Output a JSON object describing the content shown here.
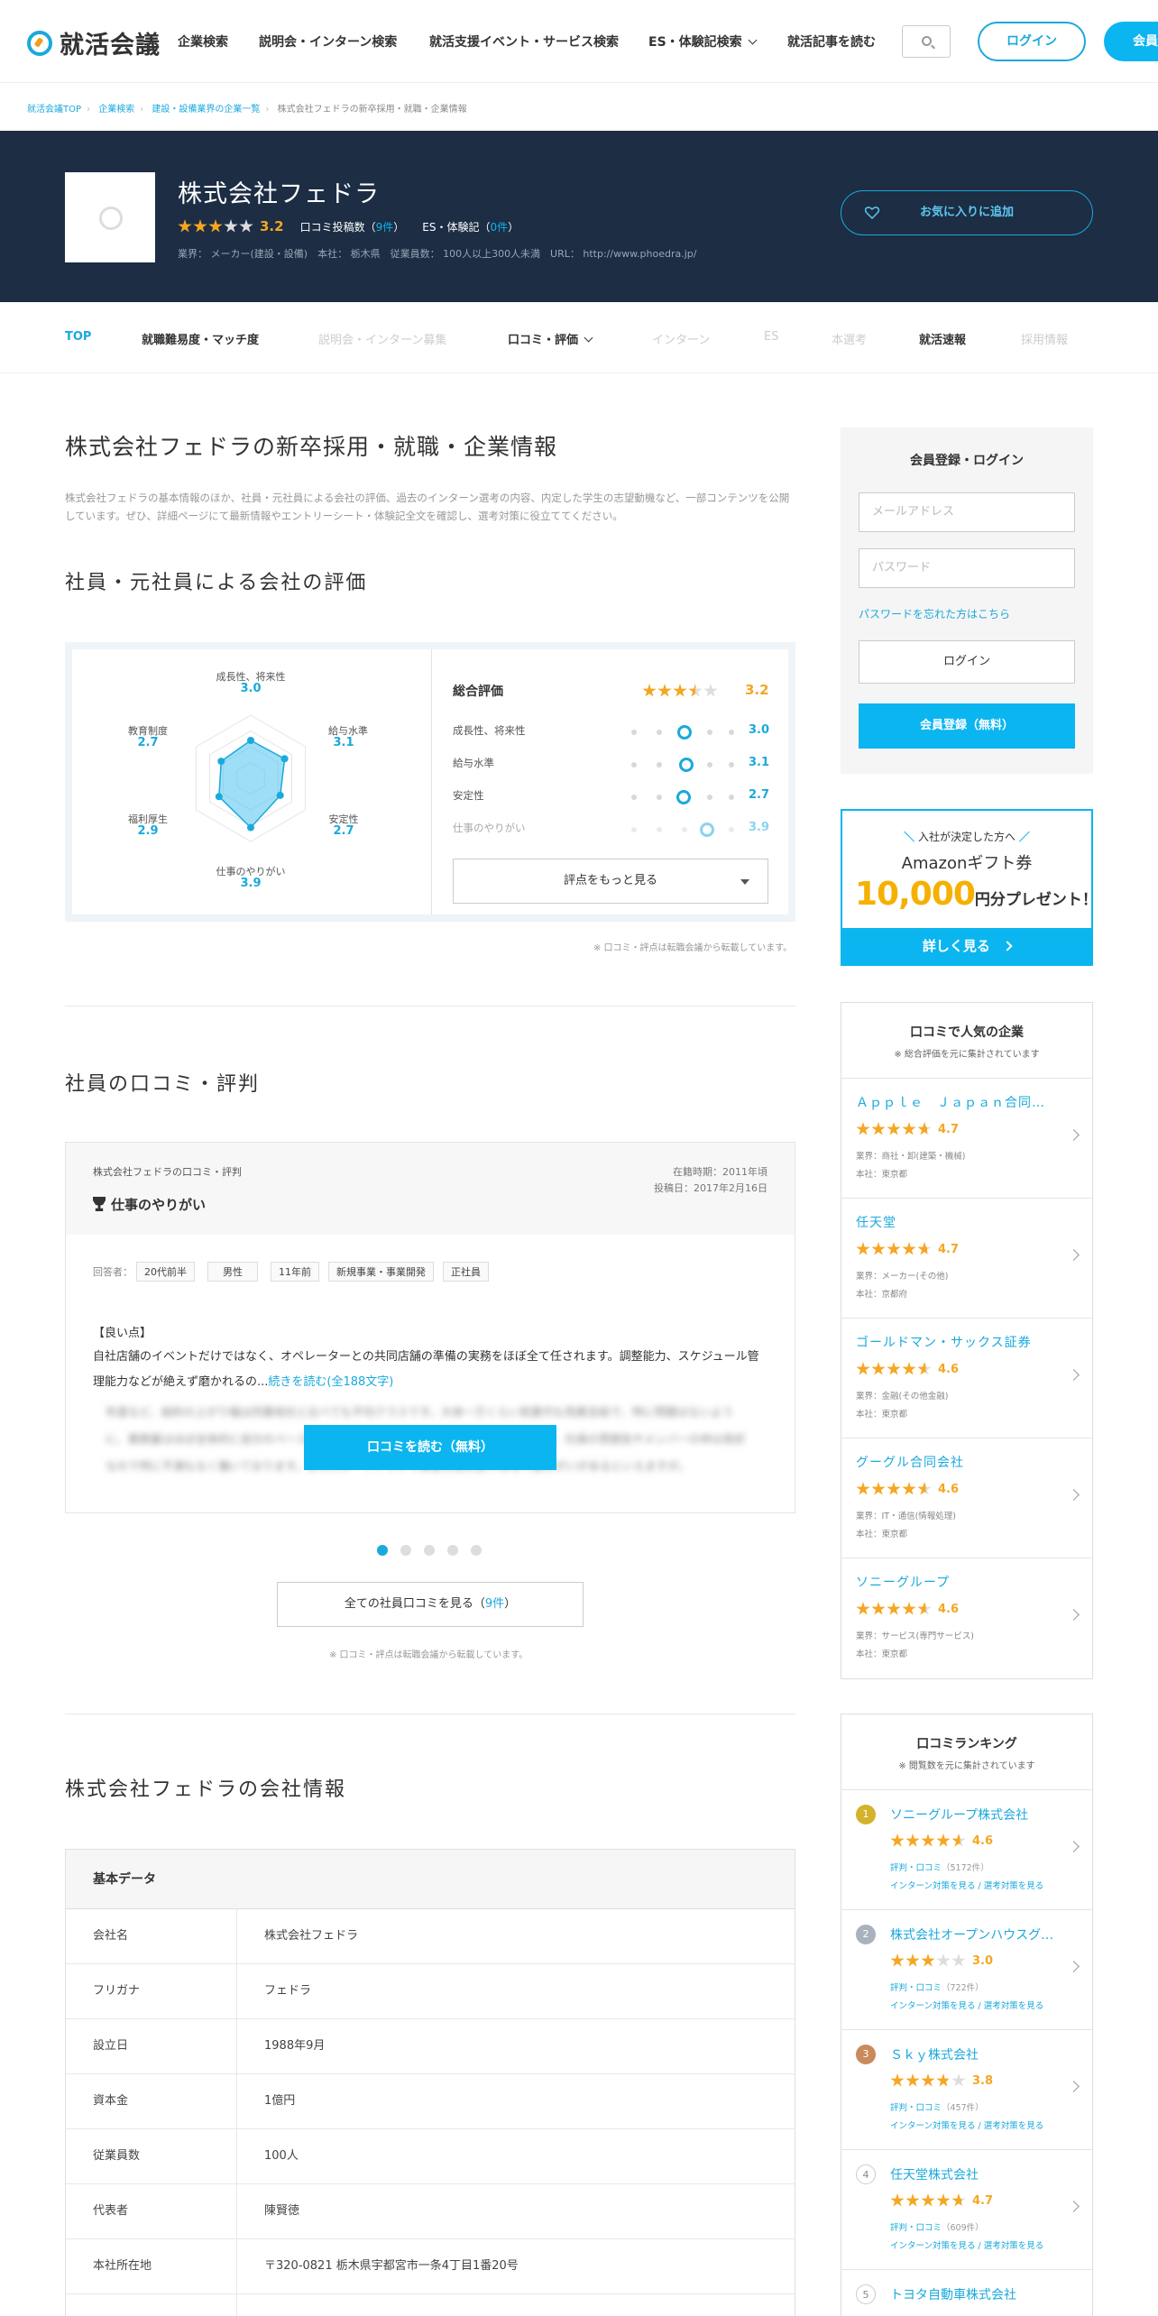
{
  "header": {
    "logo_text": "就活会議",
    "nav": [
      "企業検索",
      "説明会・インターン検索",
      "就活支援イベント・サービス検索",
      "ES・体験記検索",
      "就活記事を読む"
    ],
    "login": "ログイン",
    "register": "会員登録"
  },
  "breadcrumb": [
    "就活会議TOP",
    "企業検索",
    "建設・設備業界の企業一覧",
    "株式会社フェドラの新卒採用・就職・企業情報"
  ],
  "company": {
    "name": "株式会社フェドラ",
    "score": "3.2",
    "reviews_label": "口コミ投稿数（",
    "reviews_count": "9件",
    "es_label": "ES・体験記（",
    "es_count": "0件",
    "close": "）",
    "info": "業界： メーカー(建設・設備)　本社： 栃木県　従業員数： 100人以上300人未満　URL： http://www.phoedra.jp/",
    "favorite": "お気に入りに追加"
  },
  "tabs": [
    "TOP",
    "就職難易度・マッチ度",
    "説明会・インターン募集",
    "口コミ・評価",
    "インターン",
    "ES",
    "本選考",
    "就活速報",
    "採用情報"
  ],
  "main": {
    "title": "株式会社フェドラの新卒採用・就職・企業情報",
    "lead": "株式会社フェドラの基本情報のほか、社員・元社員による会社の評価、過去のインターン選考の内容、内定した学生の志望動機など、一部コンテンツを公開しています。ぜひ、詳細ページにて最新情報やエントリーシート・体験記全文を確認し、選考対策に役立ててください。",
    "rating_title": "社員・元社員による会社の評価",
    "radar": [
      {
        "label": "成長性、将来性",
        "value": "3.0"
      },
      {
        "label": "給与水準",
        "value": "3.1"
      },
      {
        "label": "安定性",
        "value": "2.7"
      },
      {
        "label": "仕事のやりがい",
        "value": "3.9"
      },
      {
        "label": "福利厚生",
        "value": "2.9"
      },
      {
        "label": "教育制度",
        "value": "2.7"
      }
    ],
    "total_label": "総合評価",
    "total_score": "3.2",
    "scores": [
      {
        "label": "成長性、将来性",
        "value": "3.0"
      },
      {
        "label": "給与水準",
        "value": "3.1"
      },
      {
        "label": "安定性",
        "value": "2.7"
      },
      {
        "label": "仕事のやりがい",
        "value": "3.9"
      }
    ],
    "more_scores": "評点をもっと見る",
    "note": "※ 口コミ・評点は転職会議から転載しています。",
    "review_title": "社員の口コミ・評判",
    "review": {
      "source": "株式会社フェドラの口コミ・評判",
      "tenure": "在籍時期：2011年頃",
      "posted": "投稿日：2017年2月16日",
      "category": "仕事のやりがい",
      "answerer": "回答者：",
      "tags": [
        "20代前半",
        "男性",
        "11年前",
        "新規事業・事業開発",
        "正社員"
      ],
      "good_label": "【良い点】",
      "body": "自社店舗のイベントだけではなく、オペレーターとの共同店舗の準備の実務をほぼ全て任されます。調整能力、スケジュール管理能力などが絶えず磨かれるの...",
      "read_more": "続きを読む(全188文字)",
      "blur": "年度など、給料の上がり幅は同業他社と比べても平均クラスです。大体一万くらい就業代も残業支給で、特に問題はないように、業務量はほぼ全体的に自分のペースで調整できるというわけではないようです。ただ、社員の雰囲気やメンバーの仲は良好なので特に不満もなく働いております。またスタートアップで事業も会社並ではなく働きがいがあるといえますが。",
      "read_btn": "口コミを読む（無料）"
    },
    "all_reviews": "全ての社員口コミを見る（",
    "all_reviews_count": "9件",
    "info_title": "株式会社フェドラの会社情報",
    "table_head": "基本データ",
    "table": [
      {
        "k": "会社名",
        "v": "株式会社フェドラ"
      },
      {
        "k": "フリガナ",
        "v": "フェドラ"
      },
      {
        "k": "設立日",
        "v": "1988年9月"
      },
      {
        "k": "資本金",
        "v": "1億円"
      },
      {
        "k": "従業員数",
        "v": "100人"
      },
      {
        "k": "代表者",
        "v": "陳賢徳"
      },
      {
        "k": "本社所在地",
        "v": "〒320-0821 栃木県宇都宮市一条4丁目1番20号"
      }
    ]
  },
  "sidebar": {
    "login": {
      "title": "会員登録・ログイン",
      "email_ph": "メールアドレス",
      "password_ph": "パスワード",
      "forgot": "パスワードを忘れた方はこちら",
      "login": "ログイン",
      "register": "会員登録（無料）"
    },
    "amazon": {
      "top": "入社が決定した方へ",
      "mid": "Amazonギフト券",
      "num": "10,000",
      "txt": "円分プレゼント！",
      "btn": "詳しく見る"
    },
    "popular": {
      "title": "口コミで人気の企業",
      "sub": "※ 総合評価を元に集計されています",
      "items": [
        {
          "name": "Ａｐｐｌｅ　Ｊａｐａｎ合同会社",
          "score": "4.7",
          "industry": "業界：商社・卸(建築・機械)",
          "hq": "本社：東京都",
          "stars": 4.7
        },
        {
          "name": "任天堂",
          "score": "4.7",
          "industry": "業界：メーカー(その他)",
          "hq": "本社：京都府",
          "stars": 4.7
        },
        {
          "name": "ゴールドマン・サックス証券",
          "score": "4.6",
          "industry": "業界：金融(その他金融)",
          "hq": "本社：東京都",
          "stars": 4.6
        },
        {
          "name": "グーグル合同会社",
          "score": "4.6",
          "industry": "業界：IT・通信(情報処理)",
          "hq": "本社：東京都",
          "stars": 4.6
        },
        {
          "name": "ソニーグループ",
          "score": "4.6",
          "industry": "業界：サービス(専門サービス)",
          "hq": "本社：東京都",
          "stars": 4.6
        }
      ]
    },
    "ranking": {
      "title": "口コミランキング",
      "sub": "※ 閲覧数を元に集計されています",
      "links": "インターン対策を見る / 選考対策を見る",
      "items": [
        {
          "rank": "1",
          "name": "ソニーグループ株式会社",
          "score": "4.6",
          "reviews": "評判・口コミ",
          "count": "（5172件）",
          "stars": 4.6,
          "color": "#d4b22a"
        },
        {
          "rank": "2",
          "name": "株式会社オープンハウスグループ",
          "score": "3.0",
          "reviews": "評判・口コミ",
          "count": "（722件）",
          "stars": 3.0,
          "color": "#a9b2bc"
        },
        {
          "rank": "3",
          "name": "Ｓｋｙ株式会社",
          "score": "3.8",
          "reviews": "評判・口コミ",
          "count": "（457件）",
          "stars": 3.8,
          "color": "#c98a5c"
        },
        {
          "rank": "4",
          "name": "任天堂株式会社",
          "score": "4.7",
          "reviews": "評判・口コミ",
          "count": "（609件）",
          "stars": 4.7,
          "color": "#fff"
        },
        {
          "rank": "5",
          "name": "トヨタ自動車株式会社",
          "score": "",
          "reviews": "",
          "count": "",
          "stars": 0,
          "color": "#fff"
        }
      ]
    }
  },
  "colors": {
    "accent": "#1aa9dc",
    "star": "#f5a623",
    "hero": "#1c2d44"
  }
}
